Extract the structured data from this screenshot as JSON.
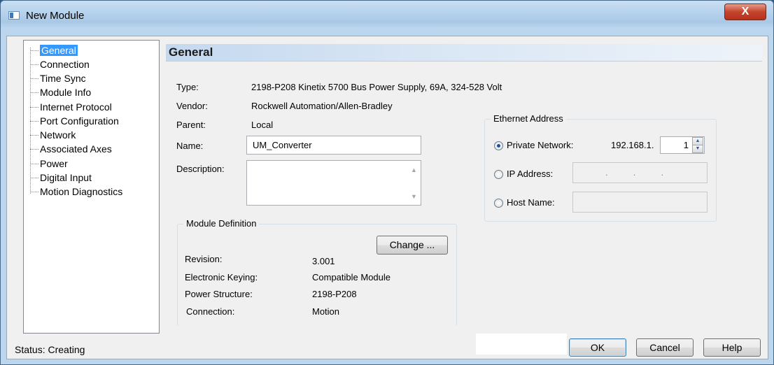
{
  "window": {
    "title": "New Module",
    "close_glyph": "X"
  },
  "tree": {
    "items": [
      "General",
      "Connection",
      "Time Sync",
      "Module Info",
      "Internet Protocol",
      "Port Configuration",
      "Network",
      "Associated Axes",
      "Power",
      "Digital Input",
      "Motion Diagnostics"
    ],
    "selected": "General"
  },
  "section": {
    "title": "General"
  },
  "fields": {
    "type_label": "Type:",
    "type_value": "2198-P208 Kinetix 5700 Bus Power Supply, 69A, 324-528 Volt",
    "vendor_label": "Vendor:",
    "vendor_value": "Rockwell Automation/Allen-Bradley",
    "parent_label": "Parent:",
    "parent_value": "Local",
    "name_label": "Name:",
    "name_value": "UM_Converter",
    "description_label": "Description:",
    "description_value": ""
  },
  "module_definition": {
    "title": "Module Definition",
    "change_button": "Change ...",
    "revision_label": "Revision:",
    "revision_value": "3.001",
    "keying_label": "Electronic Keying:",
    "keying_value": "Compatible Module",
    "power_label": "Power Structure:",
    "power_value": "2198-P208",
    "connection_label": "Connection:",
    "connection_value": "Motion"
  },
  "ethernet": {
    "title": "Ethernet Address",
    "private_label": "Private Network:",
    "private_prefix": "192.168.1.",
    "private_value": "1",
    "ip_label": "IP Address:",
    "ip_placeholder": ".          .          .",
    "host_label": "Host Name:",
    "selected": "private"
  },
  "status": {
    "text": "Status:  Creating"
  },
  "buttons": {
    "ok": "OK",
    "cancel": "Cancel",
    "help": "Help"
  },
  "icons": [
    "app-window-icon",
    "close-icon",
    "scroll-up-icon",
    "scroll-down-icon",
    "spin-up-icon",
    "spin-down-icon"
  ]
}
